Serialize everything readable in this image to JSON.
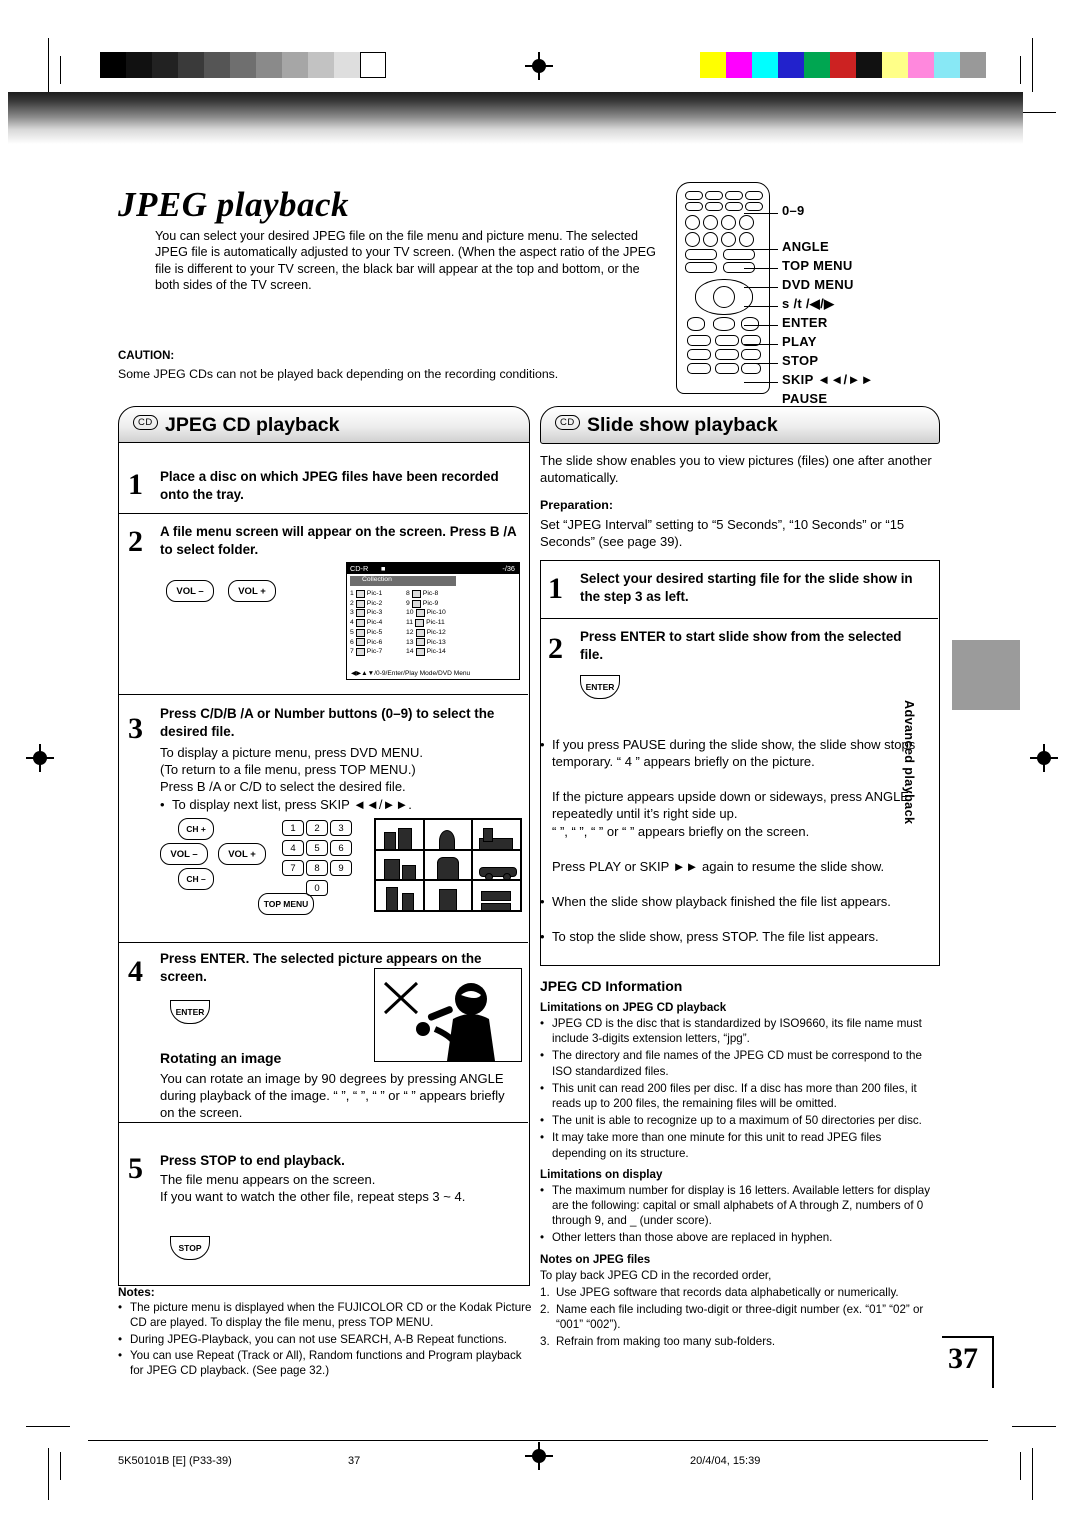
{
  "doc": {
    "title": "JPEG playback",
    "intro": "You can select your desired JPEG file on the file menu and picture menu. The selected JPEG file is automatically adjusted to your TV screen. (When the aspect ratio of the JPEG file is different to your TV screen, the black bar will appear at the top and bottom, or the both sides of the TV screen.",
    "caution_label": "CAUTION:",
    "caution_text": "Some JPEG CDs can not be played back depending on the recording conditions.",
    "page_number": "37",
    "side_tab": "Advanced playback"
  },
  "remote_labels": [
    "0–9",
    "ANGLE",
    "TOP MENU",
    "DVD MENU",
    "s /t /◀/▶",
    "ENTER",
    "PLAY",
    "STOP",
    "SKIP ◄◄/►►",
    "PAUSE"
  ],
  "left_section": {
    "cd_badge": "CD",
    "heading": "JPEG CD playback",
    "steps": [
      {
        "num": "1",
        "title": "Place a disc on which JPEG files have been recorded onto the tray."
      },
      {
        "num": "2",
        "title": "A file menu screen will appear on the screen. Press B /A  to select folder."
      },
      {
        "num": "3",
        "title": "Press C/D/B /A  or Number buttons (0–9) to select the desired file.",
        "lines": [
          "To display a picture menu, press DVD MENU.",
          "(To return to a file menu, press TOP MENU.)",
          "Press B /A  or C/D to select the desired file."
        ],
        "bullet": "To display next list, press SKIP ◄◄/►►."
      },
      {
        "num": "4",
        "title": "Press ENTER. The selected picture appears on the screen.",
        "sub_title": "Rotating an image",
        "sub_text": "You can rotate an image by 90 degrees by pressing ANGLE during playback of the image. “      ”, “      ”, “      ” or “      ” appears briefly on the screen."
      },
      {
        "num": "5",
        "title": "Press STOP to end playback.",
        "lines": [
          "The file menu appears on the screen.",
          "If you want to watch the other file, repeat steps 3 ~ 4."
        ]
      }
    ],
    "vol_minus": "VOL –",
    "vol_plus": "VOL +",
    "ch_up": "CH +",
    "ch_down": "CH –",
    "top_menu_key": "TOP MENU",
    "enter_key": "ENTER",
    "stop_key": "STOP",
    "numpad": [
      "1",
      "2",
      "3",
      "4",
      "5",
      "6",
      "7",
      "8",
      "9",
      "0"
    ],
    "screen": {
      "disc_label": "CD-R",
      "counter": "-/36",
      "folder": "Collection",
      "footer": "◀▶▲▼/0-9/Enter/Play Mode/DVD Menu",
      "files": [
        [
          "1",
          "Pic-1",
          "8",
          "Pic-8"
        ],
        [
          "2",
          "Pic-2",
          "9",
          "Pic-9"
        ],
        [
          "3",
          "Pic-3",
          "10",
          "Pic-10"
        ],
        [
          "4",
          "Pic-4",
          "11",
          "Pic-11"
        ],
        [
          "5",
          "Pic-5",
          "12",
          "Pic-12"
        ],
        [
          "6",
          "Pic-6",
          "13",
          "Pic-13"
        ],
        [
          "7",
          "Pic-7",
          "14",
          "Pic-14"
        ]
      ]
    }
  },
  "right_section": {
    "cd_badge": "CD",
    "heading": "Slide show playback",
    "intro": "The slide show enables you to view pictures (files) one after another automatically.",
    "prep_label": "Preparation:",
    "prep_text": "Set “JPEG Interval” setting to “5 Seconds”, “10 Seconds” or “15 Seconds” (see page 39).",
    "steps": [
      {
        "num": "1",
        "title": "Select your desired starting file for the slide show in the step 3 as left."
      },
      {
        "num": "2",
        "title": "Press ENTER to start slide show from the selected file.",
        "key": "ENTER"
      }
    ],
    "bullets": [
      "If you press PAUSE during the slide show, the slide show stops temporary. “ 4 ” appears briefly on the picture.",
      "When the slide show playback finished the file list appears.",
      "To stop the slide show, press STOP. The file list appears."
    ],
    "rotate_para": [
      "If the picture appears upside down or sideways, press ANGLE repeatedly until it’s right side up.",
      "“      ”, “      ”, “      ” or “      ” appears briefly on the screen.",
      "Press PLAY or SKIP ►► again to resume the slide show."
    ],
    "info_title": "JPEG CD Information",
    "limit_playback_title": "Limitations on JPEG CD playback",
    "limit_playback": [
      "JPEG CD is the disc that is standardized by ISO9660, its file name must include 3-digits extension letters, “jpg”.",
      "The directory and file names of the JPEG CD must be correspond to the ISO standardized files.",
      "This unit can read 200 files per disc. If a disc has more than 200 files, it reads up to 200 files, the remaining files will be omitted.",
      "The unit is able to recognize up to a maximum of 50 directories per disc.",
      "It may take more than one minute for this unit to read JPEG files depending on its structure."
    ],
    "limit_display_title": "Limitations on display",
    "limit_display": [
      "The maximum number for display is 16 letters. Available letters for display are the following: capital or small alphabets of A through Z, numbers of 0 through 9, and _ (under score).",
      "Other letters than those above are replaced in hyphen."
    ],
    "notes_jpeg_title": "Notes on JPEG files",
    "notes_jpeg_lead": "To play back JPEG CD in the recorded order,",
    "notes_jpeg": [
      {
        "n": "1.",
        "t": "Use JPEG software that records data alphabetically or numerically."
      },
      {
        "n": "2.",
        "t": "Name each file including two-digit or three-digit number (ex. “01” “02” or “001” “002”)."
      },
      {
        "n": "3.",
        "t": "Refrain from making too many sub-folders."
      }
    ]
  },
  "notes": {
    "label": "Notes:",
    "items": [
      "The picture menu is displayed when the FUJICOLOR CD or the Kodak Picture CD are played. To display the file menu, press TOP MENU.",
      "During JPEG-Playback, you can not use SEARCH, A-B Repeat functions.",
      "You can use Repeat (Track or All), Random functions and Program playback for JPEG CD playback. (See page 32.)"
    ]
  },
  "footer": {
    "left": "5K50101B [E] (P33-39)",
    "center": "37",
    "right": "20/4/04, 15:39"
  },
  "swatches_left": [
    "#000000",
    "#111111",
    "#222222",
    "#3a3a3a",
    "#555555",
    "#6f6f6f",
    "#8a8a8a",
    "#a6a6a6",
    "#c2c2c2",
    "#dedede",
    "#ffffff"
  ],
  "swatches_right": [
    "#ffff00",
    "#ff00ff",
    "#00ffff",
    "#2222cc",
    "#00a651",
    "#cc2222",
    "#111111",
    "#ffff88",
    "#ff88dd",
    "#88e8f5",
    "#999999"
  ]
}
